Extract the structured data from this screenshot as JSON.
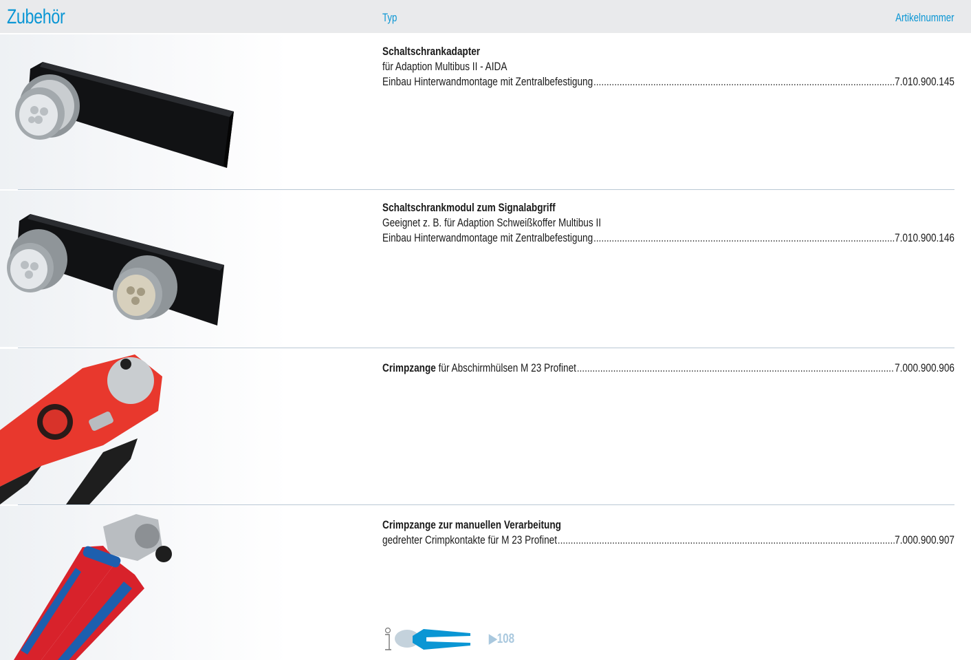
{
  "header": {
    "title": "Zubehör",
    "col_typ": "Typ",
    "col_artikel": "Artikelnummer"
  },
  "products": [
    {
      "image_name": "control-cabinet-adapter-image",
      "name": "Schaltschrankadapter",
      "line2": "für Adaption Multibus II - AIDA",
      "line3": "Einbau Hinterwandmontage mit Zentralbefestigung",
      "article": "7.010.900.145"
    },
    {
      "image_name": "control-cabinet-module-image",
      "name": "Schaltschrankmodul zum Signalabgriff",
      "line2": "Geeignet z. B. für Adaption Schweißkoffer Multibus II",
      "line3": "Einbau Hinterwandmontage mit Zentralbefestigung",
      "article": "7.010.900.146"
    },
    {
      "image_name": "crimping-pliers-red-image",
      "name": "Crimpzange",
      "rest": " für Abschirmhülsen M 23 Profinet",
      "article": "7.000.900.906"
    },
    {
      "image_name": "crimping-pliers-manual-image",
      "name": "Crimpzange zur manuellen Verarbeitung",
      "line2": "gedrehter Crimpkontakte für M 23 Profinet",
      "article": "7.000.900.907"
    }
  ],
  "info_reference": {
    "icon": "info-icon",
    "label": "▶108"
  },
  "colors": {
    "accent": "#0a96d4",
    "header_bg": "#e9eaec",
    "divider": "#b9c7d4"
  }
}
